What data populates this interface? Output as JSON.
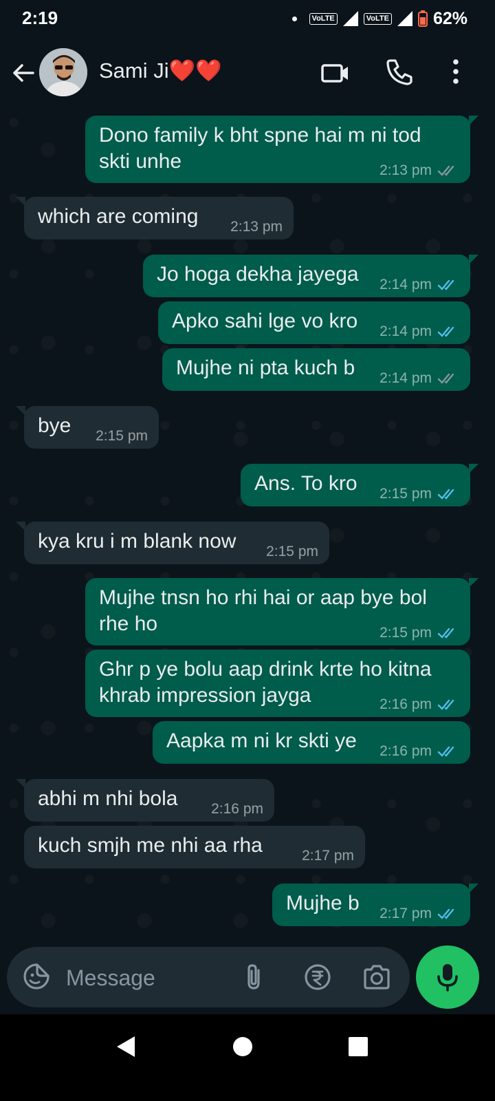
{
  "status_bar": {
    "time": "2:19",
    "network_labels": [
      "VoLTE",
      "VoLTE"
    ],
    "battery_percent": "62%"
  },
  "header": {
    "contact_name": "Sami Ji❤️❤️",
    "icons": [
      "back-arrow-icon",
      "video-call-icon",
      "voice-call-icon",
      "more-options-icon"
    ]
  },
  "messages": [
    {
      "dir": "out",
      "text": "Dono family k bht spne hai m ni tod skti unhe",
      "time": "2:13 pm",
      "status": "delivered"
    },
    {
      "dir": "in",
      "text": "which are coming",
      "time": "2:13 pm"
    },
    {
      "dir": "out",
      "text": "Jo hoga dekha jayega",
      "time": "2:14 pm",
      "status": "read"
    },
    {
      "dir": "out",
      "text": "Apko sahi lge vo kro",
      "time": "2:14 pm",
      "status": "read"
    },
    {
      "dir": "out",
      "text": "Mujhe ni pta kuch b",
      "time": "2:14 pm",
      "status": "delivered"
    },
    {
      "dir": "in",
      "text": "bye",
      "time": "2:15 pm"
    },
    {
      "dir": "out",
      "text": "Ans. To kro",
      "time": "2:15 pm",
      "status": "read"
    },
    {
      "dir": "in",
      "text": "kya kru i m blank now",
      "time": "2:15 pm"
    },
    {
      "dir": "out",
      "text": "Mujhe tnsn ho rhi hai or aap bye bol rhe ho",
      "time": "2:15 pm",
      "status": "read"
    },
    {
      "dir": "out",
      "text": "Ghr p ye bolu aap drink krte ho kitna khrab impression jayga",
      "time": "2:16 pm",
      "status": "read"
    },
    {
      "dir": "out",
      "text": "Aapka m ni kr skti ye",
      "time": "2:16 pm",
      "status": "read"
    },
    {
      "dir": "in",
      "text": "abhi m nhi bola",
      "time": "2:16 pm"
    },
    {
      "dir": "in",
      "text": "kuch smjh me nhi aa rha",
      "time": "2:17 pm"
    },
    {
      "dir": "out",
      "text": "Mujhe b",
      "time": "2:17 pm",
      "status": "read"
    }
  ],
  "input": {
    "placeholder": "Message",
    "icons": [
      "emoji-sticker-icon",
      "attach-icon",
      "rupee-payment-icon",
      "camera-icon",
      "mic-icon"
    ]
  },
  "colors": {
    "background": "#0b141a",
    "outgoing_bubble": "#005c4b",
    "incoming_bubble": "#1f2c34",
    "read_tick": "#53bdeb",
    "delivered_tick": "#8696a0",
    "mic_button": "#21c063"
  }
}
